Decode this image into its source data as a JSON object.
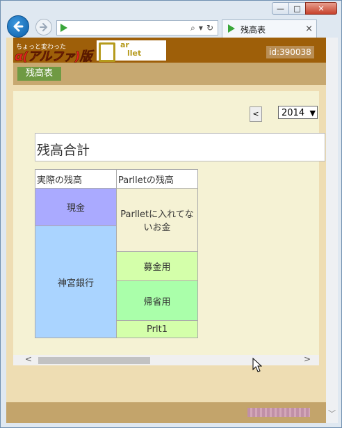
{
  "browser": {
    "tab_title": "残高表",
    "window_controls": {
      "minimize": "—",
      "maximize": "□",
      "close": "✕"
    },
    "address_tools": [
      "⌕",
      "▾",
      "↻"
    ]
  },
  "app": {
    "logo_tagline": "ちょっと変わった",
    "logo_brand": "α(アルファ)版",
    "logo_parllet_top": "ar",
    "logo_parllet_bottom": "llet",
    "user_id": "id:390038",
    "nav_button": "残高表"
  },
  "controls": {
    "prev_label": "<",
    "year": "2014"
  },
  "section_title": "残高合計",
  "table": {
    "headers": [
      "実際の残高",
      "Parlletの残高"
    ],
    "actual": [
      {
        "label": "現金",
        "color": "#aaaaff"
      },
      {
        "label": "神宮銀行",
        "color": "#aad4ff"
      }
    ],
    "parllet": [
      {
        "label": "Parlletに入れてないお金",
        "color": "#f5f2d4"
      },
      {
        "label": "募金用",
        "color": "#d4ffaa"
      },
      {
        "label": "帰省用",
        "color": "#aaffaa"
      },
      {
        "label": "Prlt1",
        "color": "#d4ffaa"
      }
    ]
  },
  "scroll": {
    "left": "<",
    "right": ">"
  }
}
